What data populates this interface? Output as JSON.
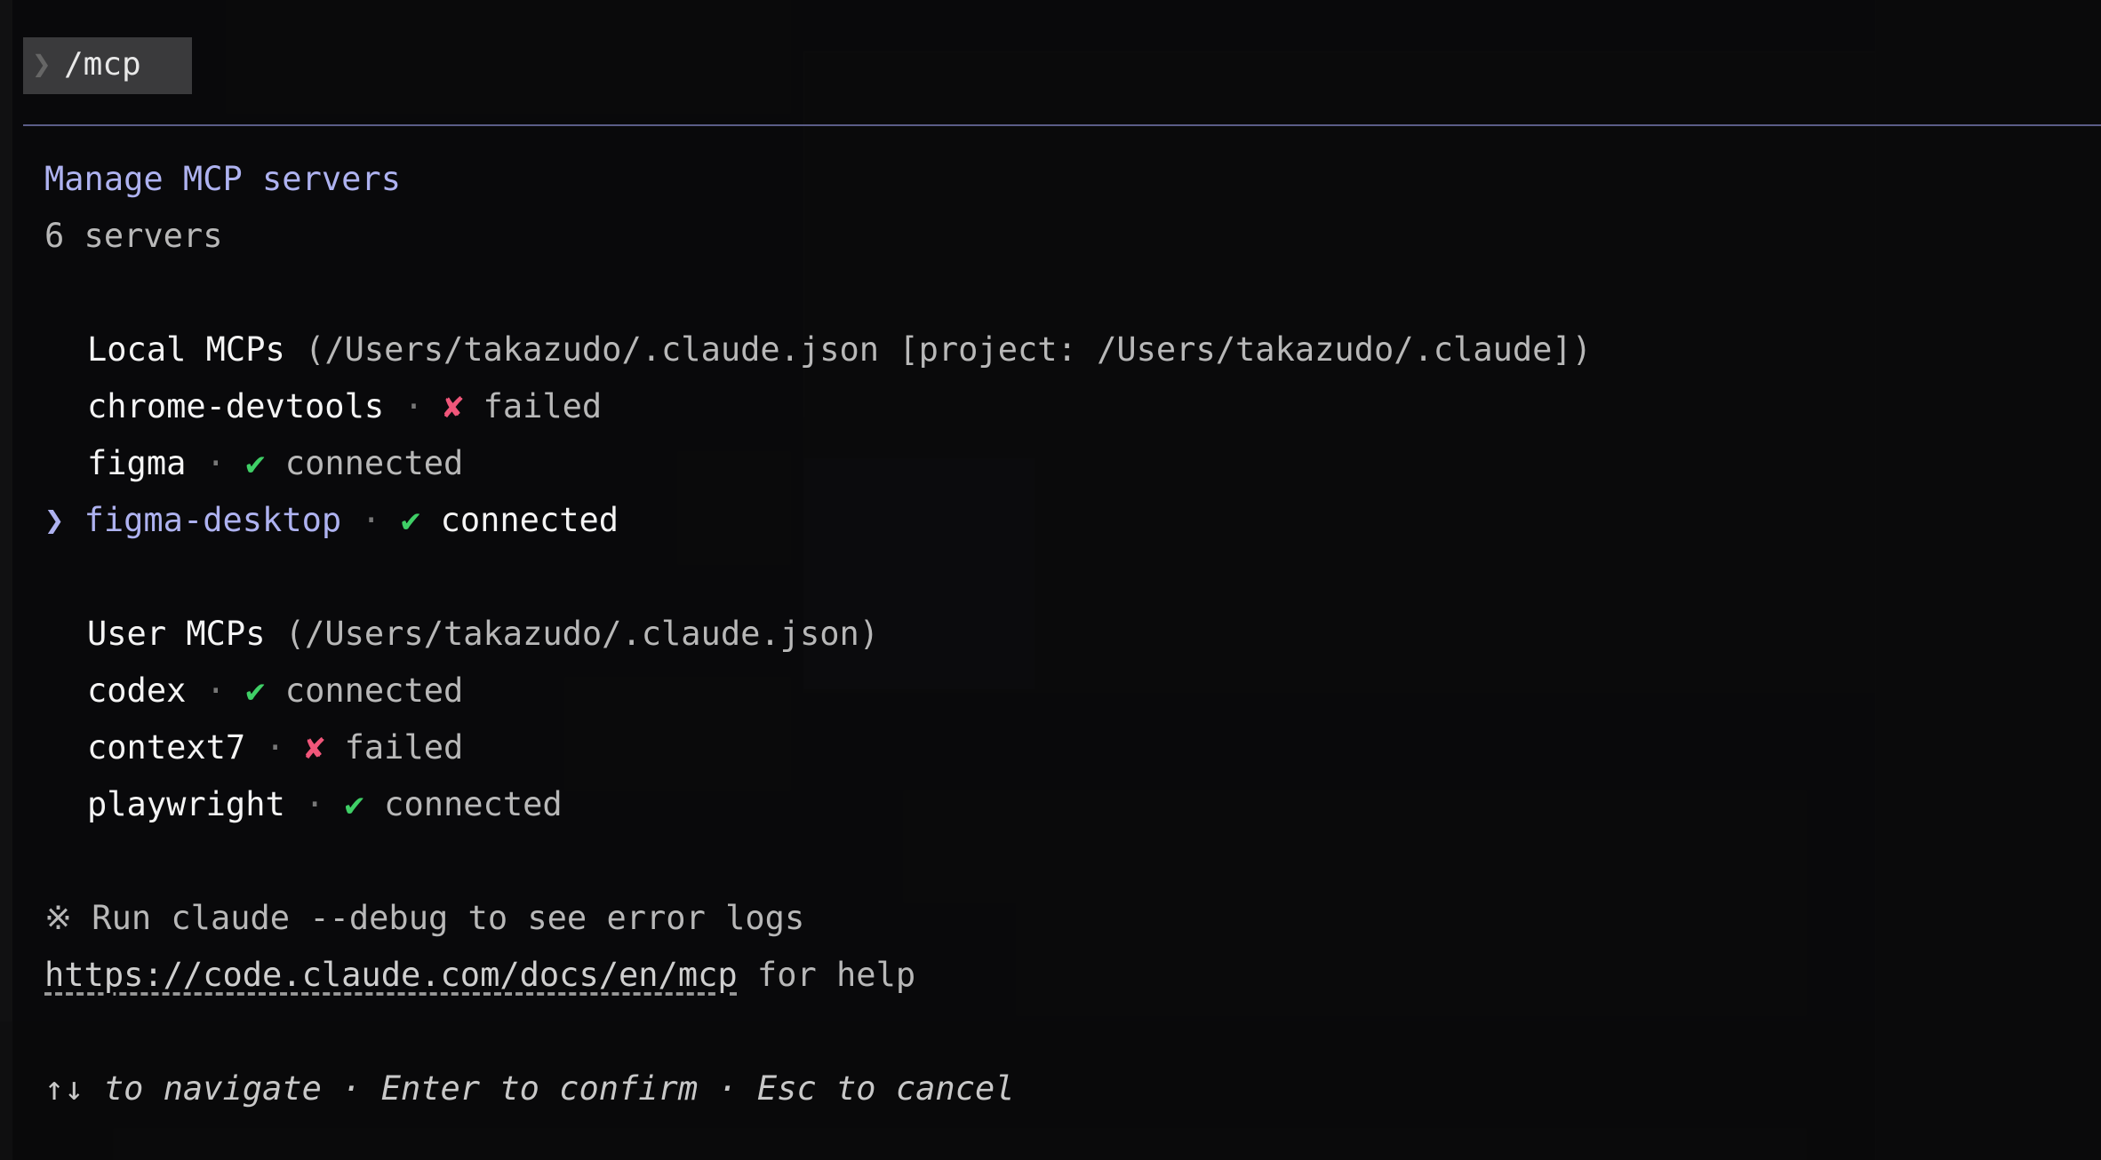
{
  "command": {
    "prompt": "❯",
    "text": "/mcp"
  },
  "header": {
    "title": "Manage MCP servers",
    "count": "6 servers"
  },
  "groups": [
    {
      "label": "Local MCPs",
      "path": "(/Users/takazudo/.claude.json [project: /Users/takazudo/.claude])",
      "servers": [
        {
          "name": "chrome-devtools",
          "status_icon": "✘",
          "status": "failed",
          "state": "failed"
        },
        {
          "name": "figma",
          "status_icon": "✔",
          "status": "connected",
          "state": "connected"
        },
        {
          "name": "figma-desktop",
          "status_icon": "✔",
          "status": "connected",
          "state": "connected",
          "selected": true
        }
      ]
    },
    {
      "label": "User MCPs",
      "path": "(/Users/takazudo/.claude.json)",
      "servers": [
        {
          "name": "codex",
          "status_icon": "✔",
          "status": "connected",
          "state": "connected"
        },
        {
          "name": "context7",
          "status_icon": "✘",
          "status": "failed",
          "state": "failed"
        },
        {
          "name": "playwright",
          "status_icon": "✔",
          "status": "connected",
          "state": "connected"
        }
      ]
    }
  ],
  "selector": "❯",
  "separator": "·",
  "footer": {
    "note_mark": "※",
    "note": "Run claude --debug to see error logs",
    "url": "https://code.claude.com/docs/en/mcp",
    "url_suffix": " for help",
    "hints": "↑↓ to navigate · Enter to confirm · Esc to cancel"
  },
  "colors": {
    "accent": "#aeb2f0",
    "connected": "#3fcf66",
    "failed": "#f0567a",
    "divider": "#5b5d88"
  }
}
